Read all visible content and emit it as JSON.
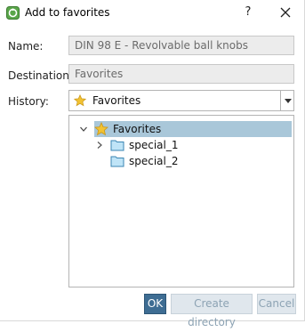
{
  "window": {
    "title": "Add to favorites",
    "help_label": "?"
  },
  "form": {
    "name_label": "Name:",
    "name_value": "DIN 98 E - Revolvable ball knobs",
    "destination_label": "Destination:",
    "destination_value": "Favorites",
    "history_label": "History:",
    "history_value": "Favorites"
  },
  "tree": {
    "root": {
      "label": "Favorites",
      "expanded": true,
      "selected": true
    },
    "children": [
      {
        "label": "special_1",
        "has_children": true
      },
      {
        "label": "special_2",
        "has_children": false
      }
    ]
  },
  "buttons": {
    "ok": "OK",
    "create_directory": "Create directory",
    "cancel": "Cancel"
  },
  "colors": {
    "selection": "#a9c7d9",
    "primary_button": "#3e6d93",
    "star": "#f2c232",
    "folder": "#bfe4f7"
  }
}
